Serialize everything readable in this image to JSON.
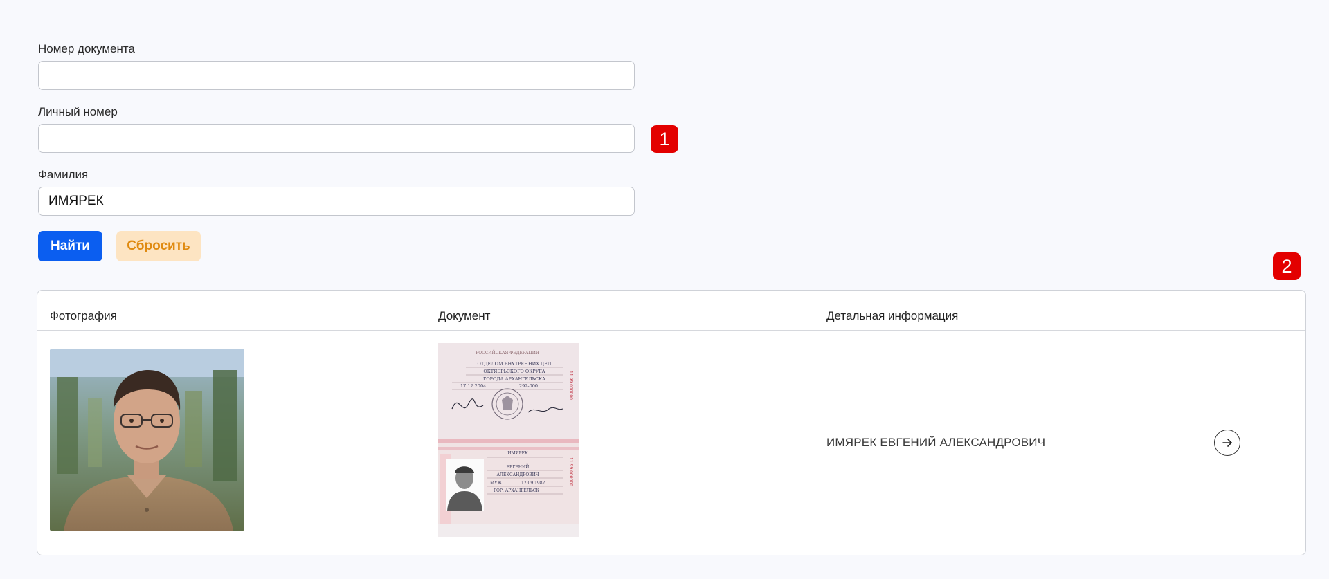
{
  "form": {
    "doc_number_label": "Номер документа",
    "doc_number_value": "",
    "personal_number_label": "Личный номер",
    "personal_number_value": "",
    "surname_label": "Фамилия",
    "surname_value": "ИМЯРЕК",
    "find_label": "Найти",
    "reset_label": "Сбросить"
  },
  "badges": {
    "one": "1",
    "two": "2"
  },
  "table": {
    "columns": [
      "Фотография",
      "Документ",
      "Детальная информация"
    ],
    "rows": [
      {
        "photo_icon": "person-photo",
        "document_icon": "passport-scan",
        "detail": "ИМЯРЕК ЕВГЕНИЙ АЛЕКСАНДРОВИЧ",
        "action_icon": "arrow-right-icon"
      }
    ]
  },
  "passport_text": {
    "header": "РОССИЙСКАЯ ФЕДЕРАЦИЯ",
    "issuer_1": "ОТДЕЛОМ ВНУТРЕННИХ ДЕЛ",
    "issuer_2": "ОКТЯБРЬСКОГО ОКРУГА",
    "issuer_3": "ГОРОДА АРХАНГЕЛЬСКА",
    "issue_date": "17.12.2004",
    "code": "292-000",
    "surname": "ИМЯРЕК",
    "given_name": "ЕВГЕНИЙ",
    "patronymic": "АЛЕКСАНДРОВИЧ",
    "sex": "МУЖ.",
    "birth_date": "12.09.1982",
    "birthplace": "ГОР. АРХАНГЕЛЬСК"
  },
  "colors": {
    "primary": "#0b5ef0",
    "reset_bg": "#fde4c2",
    "reset_text": "#e08a10",
    "badge": "#e30000"
  }
}
